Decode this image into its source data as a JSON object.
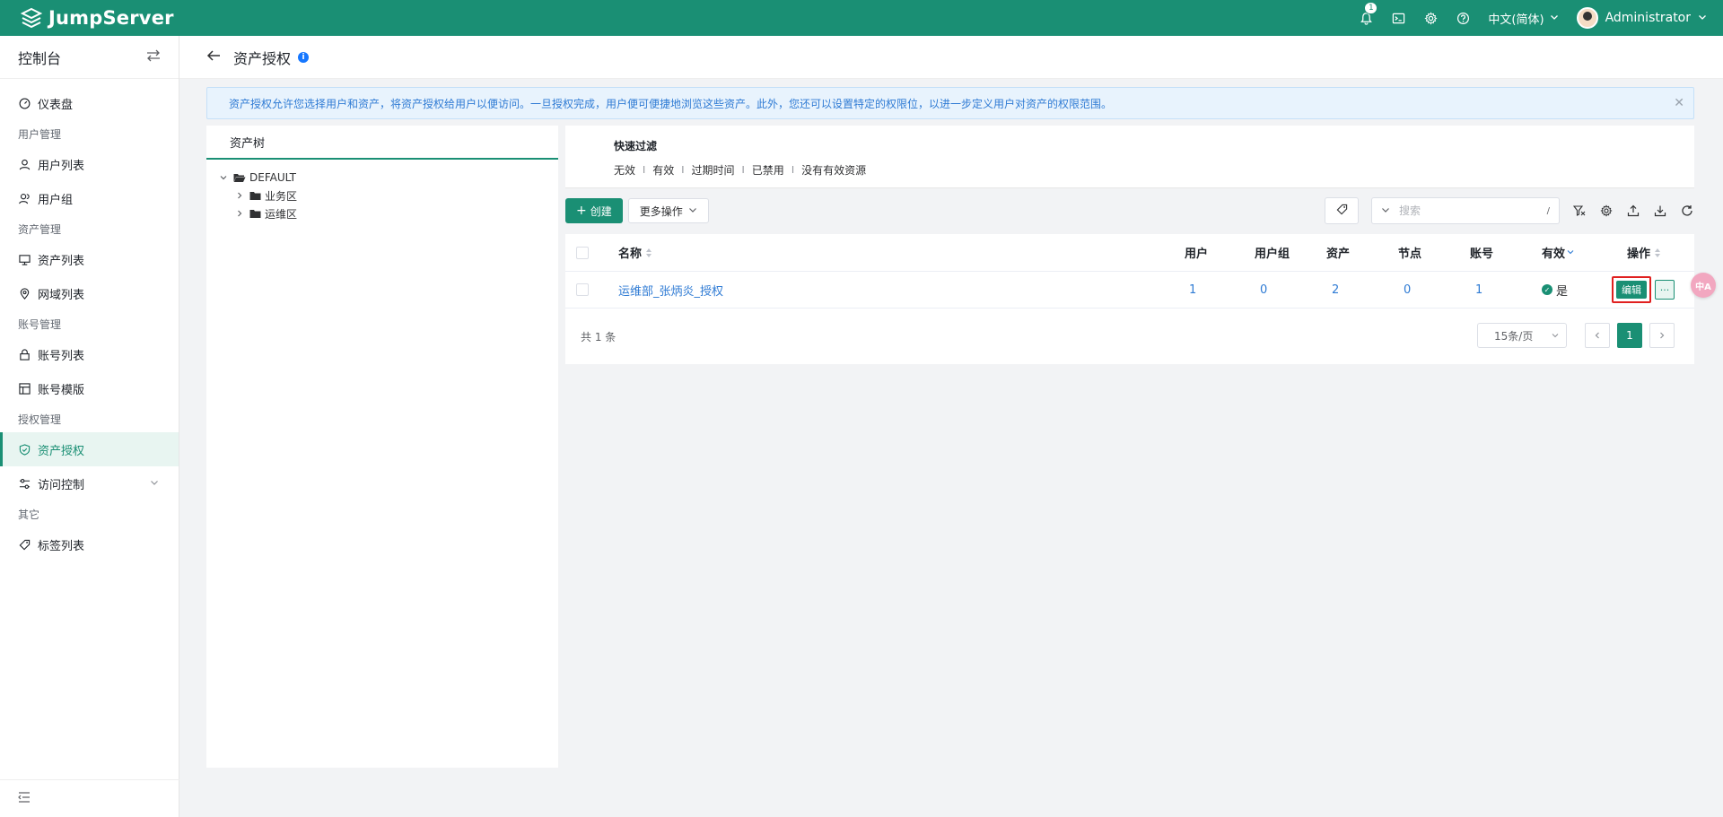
{
  "app": {
    "name": "JumpServer"
  },
  "header": {
    "notification_count": "1",
    "language": "中文(简体)",
    "user_name": "Administrator"
  },
  "sidebar": {
    "title": "控制台",
    "items": [
      {
        "type": "item",
        "label": "仪表盘",
        "icon": "dashboard-icon"
      },
      {
        "type": "group",
        "label": "用户管理"
      },
      {
        "type": "item",
        "label": "用户列表",
        "icon": "user-icon"
      },
      {
        "type": "item",
        "label": "用户组",
        "icon": "user-group-icon"
      },
      {
        "type": "group",
        "label": "资产管理"
      },
      {
        "type": "item",
        "label": "资产列表",
        "icon": "monitor-icon"
      },
      {
        "type": "item",
        "label": "网域列表",
        "icon": "location-icon"
      },
      {
        "type": "group",
        "label": "账号管理"
      },
      {
        "type": "item",
        "label": "账号列表",
        "icon": "lock-icon"
      },
      {
        "type": "item",
        "label": "账号模版",
        "icon": "template-icon"
      },
      {
        "type": "group",
        "label": "授权管理"
      },
      {
        "type": "item",
        "label": "资产授权",
        "icon": "shield-icon",
        "active": true
      },
      {
        "type": "item",
        "label": "访问控制",
        "icon": "access-control-icon",
        "expandable": true
      },
      {
        "type": "group",
        "label": "其它"
      },
      {
        "type": "item",
        "label": "标签列表",
        "icon": "tag-icon"
      }
    ]
  },
  "page": {
    "title": "资产授权"
  },
  "alert": {
    "text": "资产授权允许您选择用户和资产，将资产授权给用户以便访问。一旦授权完成，用户便可便捷地浏览这些资产。此外，您还可以设置特定的权限位，以进一步定义用户对资产的权限范围。"
  },
  "tree": {
    "tab": "资产树",
    "root": "DEFAULT",
    "children": [
      "业务区",
      "运维区"
    ]
  },
  "filter": {
    "title": "快速过滤",
    "options": [
      "无效",
      "有效",
      "过期时间",
      "已禁用",
      "没有有效资源"
    ],
    "separator": "I"
  },
  "toolbar": {
    "create_label": "创建",
    "more_label": "更多操作",
    "search_placeholder": "搜索",
    "search_shortcut": "/"
  },
  "table": {
    "columns": {
      "name": "名称",
      "users": "用户",
      "user_groups": "用户组",
      "assets": "资产",
      "nodes": "节点",
      "accounts": "账号",
      "valid": "有效",
      "actions": "操作"
    },
    "rows": [
      {
        "name": "运维部_张炳炎_授权",
        "users": "1",
        "user_groups": "0",
        "assets": "2",
        "nodes": "0",
        "accounts": "1",
        "valid": "是"
      }
    ],
    "edit_label": "编辑",
    "more_label": "···"
  },
  "footer": {
    "total": "共 1 条",
    "page_size": "15条/页",
    "current_page": "1"
  },
  "translate_button": "中A",
  "colors": {
    "brand": "#1a8f74",
    "link": "#2f7bd4",
    "highlight": "#e02020"
  }
}
